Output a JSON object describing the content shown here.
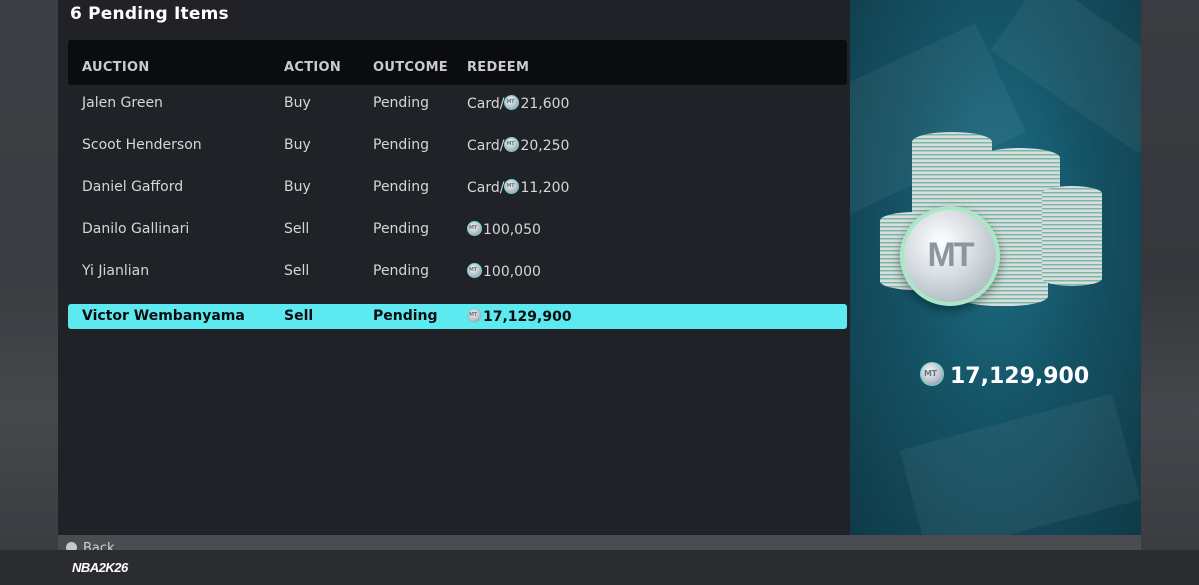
{
  "panel": {
    "title": "6 Pending Items"
  },
  "table": {
    "headers": [
      "AUCTION",
      "ACTION",
      "OUTCOME",
      "REDEEM"
    ],
    "rows": [
      {
        "auction": "Jalen Green",
        "action": "Buy",
        "outcome": "Pending",
        "redeem_prefix": "Card/",
        "redeem_amount": "21,600"
      },
      {
        "auction": "Scoot Henderson",
        "action": "Buy",
        "outcome": "Pending",
        "redeem_prefix": "Card/",
        "redeem_amount": "20,250"
      },
      {
        "auction": "Daniel Gafford",
        "action": "Buy",
        "outcome": "Pending",
        "redeem_prefix": "Card/",
        "redeem_amount": "11,200"
      },
      {
        "auction": "Danilo Gallinari",
        "action": "Sell",
        "outcome": "Pending",
        "redeem_prefix": "",
        "redeem_amount": "100,050"
      },
      {
        "auction": "Yi Jianlian",
        "action": "Sell",
        "outcome": "Pending",
        "redeem_prefix": "",
        "redeem_amount": "100,000"
      },
      {
        "auction": "Victor Wembanyama",
        "action": "Sell",
        "outcome": "Pending",
        "redeem_prefix": "",
        "redeem_amount": "17,129,900"
      }
    ],
    "selected_index": 5
  },
  "side": {
    "coin_label": "MT",
    "total": "17,129,900"
  },
  "bottom": {
    "back_label": "Back"
  },
  "footer": {
    "logo": "NBA2K26"
  },
  "colors": {
    "selection": "#5ce9f0",
    "panel_bg": "#202227",
    "side_bg": "#155366"
  },
  "icons": {
    "currency": "mt-coin-icon",
    "back": "circle-button-icon"
  }
}
